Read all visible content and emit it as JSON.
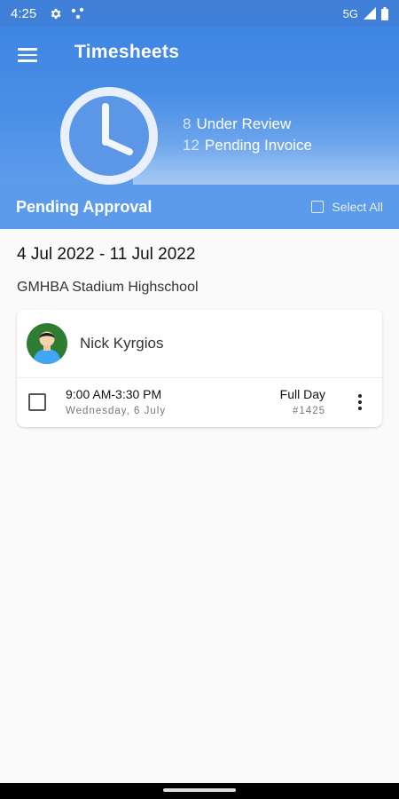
{
  "status_bar": {
    "time": "4:25",
    "network": "5G"
  },
  "header": {
    "title": "Timesheets"
  },
  "stats": [
    {
      "count": "8",
      "label": "Under Review"
    },
    {
      "count": "12",
      "label": "Pending Invoice"
    }
  ],
  "pending": {
    "title": "Pending Approval",
    "select_all_label": "Select All"
  },
  "group": {
    "date_range": "4 Jul 2022 - 11 Jul 2022",
    "school": "GMHBA Stadium Highschool"
  },
  "card": {
    "person_name": "Nick Kyrgios",
    "entries": [
      {
        "time_range": "9:00 AM-3:30 PM",
        "day": "Wednesday, 6 July",
        "type": "Full Day",
        "ref": "#1425"
      }
    ]
  },
  "icons": [
    "menu-icon",
    "clock-icon",
    "gear-icon",
    "notification-dots-icon",
    "signal-icon",
    "battery-icon",
    "more-vertical-icon"
  ],
  "colors": {
    "primary": "#3f85e3",
    "pending_bar": "#5c9bec",
    "avatar_bg": "#2e7d32"
  }
}
